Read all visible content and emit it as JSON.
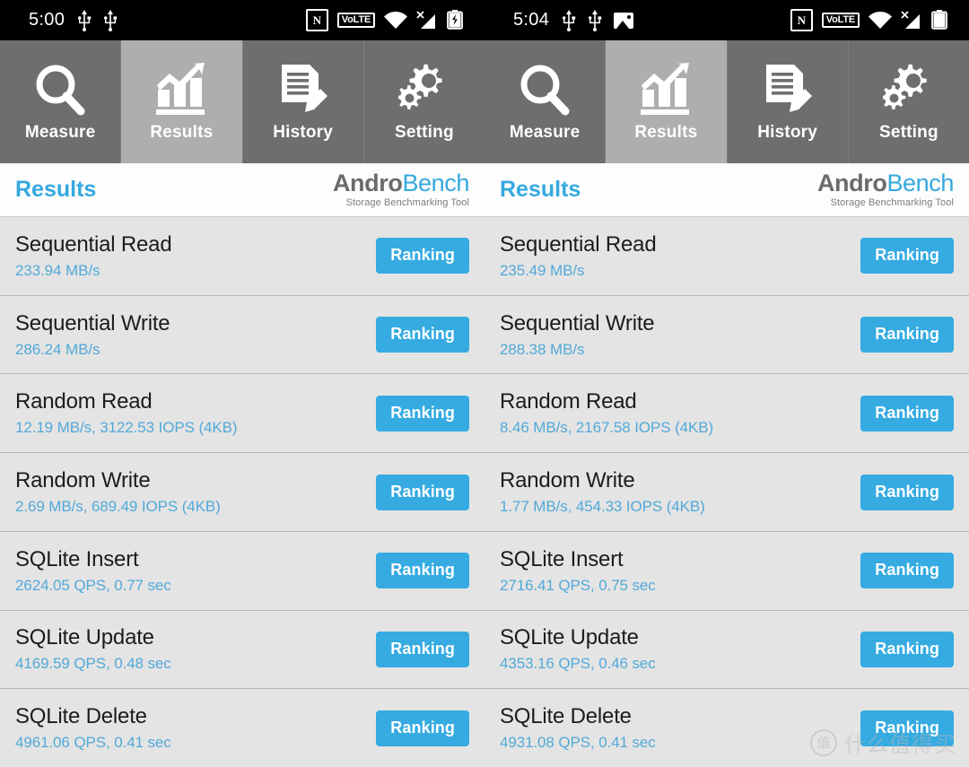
{
  "panels": [
    {
      "statusbar": {
        "time": "5:00",
        "left_icons": [
          "usb-icon",
          "usb-icon"
        ],
        "right_icons": [
          "nfc-icon",
          "volte-icon",
          "wifi-icon",
          "signal-no-service-icon",
          "battery-charging-icon"
        ],
        "nfc_label": "N",
        "volte_label": "VoLTE",
        "battery": "charging"
      },
      "tabs": [
        {
          "label": "Measure",
          "icon": "magnifier-icon",
          "active": false
        },
        {
          "label": "Results",
          "icon": "bar-chart-icon",
          "active": true
        },
        {
          "label": "History",
          "icon": "document-pencil-icon",
          "active": false
        },
        {
          "label": "Setting",
          "icon": "gears-icon",
          "active": false
        }
      ],
      "header": {
        "title": "Results",
        "logo_name_dark": "Andro",
        "logo_name_blue": "Bench",
        "logo_sub": "Storage Benchmarking Tool"
      },
      "rows": [
        {
          "title": "Sequential Read",
          "value": "233.94 MB/s",
          "button": "Ranking"
        },
        {
          "title": "Sequential Write",
          "value": "286.24 MB/s",
          "button": "Ranking"
        },
        {
          "title": "Random Read",
          "value": "12.19 MB/s, 3122.53 IOPS (4KB)",
          "button": "Ranking"
        },
        {
          "title": "Random Write",
          "value": "2.69 MB/s, 689.49 IOPS (4KB)",
          "button": "Ranking"
        },
        {
          "title": "SQLite Insert",
          "value": "2624.05 QPS, 0.77 sec",
          "button": "Ranking"
        },
        {
          "title": "SQLite Update",
          "value": "4169.59 QPS, 0.48 sec",
          "button": "Ranking"
        },
        {
          "title": "SQLite Delete",
          "value": "4961.06 QPS, 0.41 sec",
          "button": "Ranking"
        }
      ]
    },
    {
      "statusbar": {
        "time": "5:04",
        "left_icons": [
          "usb-icon",
          "usb-icon",
          "picture-icon"
        ],
        "right_icons": [
          "nfc-icon",
          "volte-icon",
          "wifi-icon",
          "signal-no-service-icon",
          "battery-icon"
        ],
        "nfc_label": "N",
        "volte_label": "VoLTE",
        "battery": "full"
      },
      "tabs": [
        {
          "label": "Measure",
          "icon": "magnifier-icon",
          "active": false
        },
        {
          "label": "Results",
          "icon": "bar-chart-icon",
          "active": true
        },
        {
          "label": "History",
          "icon": "document-pencil-icon",
          "active": false
        },
        {
          "label": "Setting",
          "icon": "gears-icon",
          "active": false
        }
      ],
      "header": {
        "title": "Results",
        "logo_name_dark": "Andro",
        "logo_name_blue": "Bench",
        "logo_sub": "Storage Benchmarking Tool"
      },
      "rows": [
        {
          "title": "Sequential Read",
          "value": "235.49 MB/s",
          "button": "Ranking"
        },
        {
          "title": "Sequential Write",
          "value": "288.38 MB/s",
          "button": "Ranking"
        },
        {
          "title": "Random Read",
          "value": "8.46 MB/s, 2167.58 IOPS (4KB)",
          "button": "Ranking"
        },
        {
          "title": "Random Write",
          "value": "1.77 MB/s, 454.33 IOPS (4KB)",
          "button": "Ranking"
        },
        {
          "title": "SQLite Insert",
          "value": "2716.41 QPS, 0.75 sec",
          "button": "Ranking"
        },
        {
          "title": "SQLite Update",
          "value": "4353.16 QPS, 0.46 sec",
          "button": "Ranking"
        },
        {
          "title": "SQLite Delete",
          "value": "4931.08 QPS, 0.41 sec",
          "button": "Ranking"
        }
      ]
    }
  ],
  "watermark": {
    "badge": "值",
    "text": "什么值得买"
  },
  "colors": {
    "accent_blue": "#35abe2",
    "value_blue": "#52a9d8",
    "tab_inactive": "#6e6e6e",
    "tab_active": "#aeaeae",
    "row_bg": "#e4e4e4",
    "header_bg": "#fdfdfd",
    "statusbar_bg": "#000000"
  }
}
